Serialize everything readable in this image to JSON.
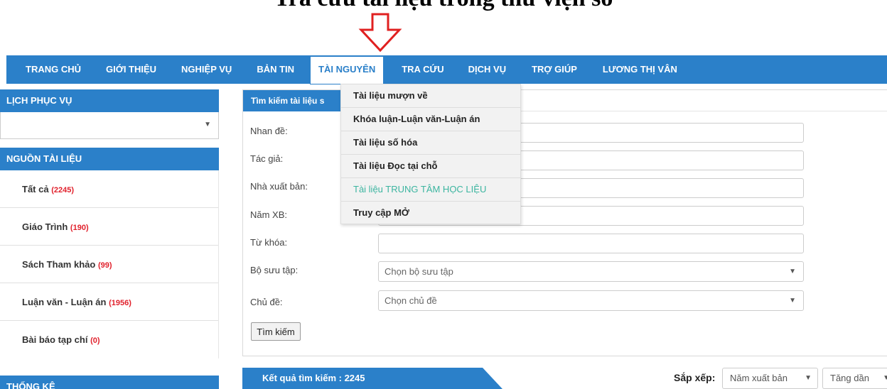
{
  "top_heading": "Tra cứu tài liệu trong thư viện số",
  "nav": {
    "items": [
      {
        "label": "TRANG CHỦ",
        "active": false
      },
      {
        "label": "GIỚI THIỆU",
        "active": false
      },
      {
        "label": "NGHIỆP VỤ",
        "active": false
      },
      {
        "label": "BẢN TIN",
        "active": false
      },
      {
        "label": "TÀI NGUYÊN",
        "active": true
      },
      {
        "label": "TRA CỨU",
        "active": false
      },
      {
        "label": "DỊCH VỤ",
        "active": false
      },
      {
        "label": "TRỢ GIÚP",
        "active": false
      },
      {
        "label": "LƯƠNG THỊ VÂN",
        "active": false
      }
    ]
  },
  "sidebar": {
    "schedule_title": "LỊCH PHỤC VỤ",
    "schedule_value": "",
    "sources_title": "NGUỒN TÀI LIỆU",
    "sources": [
      {
        "label": "Tất cả",
        "count": "(2245)"
      },
      {
        "label": "Giáo Trình",
        "count": "(190)"
      },
      {
        "label": "Sách Tham khảo",
        "count": "(99)"
      },
      {
        "label": "Luận văn - Luận án",
        "count": "(1956)"
      },
      {
        "label": "Bài báo tạp chí",
        "count": "(0)"
      }
    ],
    "stats_title": "THỐNG KÊ"
  },
  "search": {
    "title": "Tìm kiếm tài liệu s",
    "fields": {
      "title_label": "Nhan đề:",
      "author_label": "Tác giả:",
      "publisher_label": "Nhà xuất bản:",
      "year_label": "Năm XB:",
      "keyword_label": "Từ khóa:",
      "collection_label": "Bộ sưu tập:",
      "collection_placeholder": "Chọn bộ sưu tập",
      "topic_label": "Chủ đề:",
      "topic_placeholder": "Chọn chủ đề"
    },
    "button_label": "Tìm kiếm"
  },
  "dropdown": {
    "items": [
      {
        "label": "Tài liệu mượn về",
        "highlight": false
      },
      {
        "label": "Khóa luận-Luận văn-Luận án",
        "highlight": false
      },
      {
        "label": "Tài liệu số hóa",
        "highlight": false
      },
      {
        "label": "Tài liệu Đọc tại chỗ",
        "highlight": false
      },
      {
        "label": "Tài liệu TRUNG TÂM HỌC LIỆU",
        "highlight": true
      },
      {
        "label": "Truy cập MỞ",
        "highlight": false
      }
    ]
  },
  "results": {
    "label": "Kết quả tìm kiếm : 2245",
    "sort_label": "Sắp xếp:",
    "sort_by": "Năm xuất bản",
    "sort_order": "Tăng dần"
  },
  "colors": {
    "primary": "#2b80c9",
    "count_red": "#e1212c",
    "highlight_teal": "#3cb5a0",
    "arrow_red": "#e02020"
  }
}
